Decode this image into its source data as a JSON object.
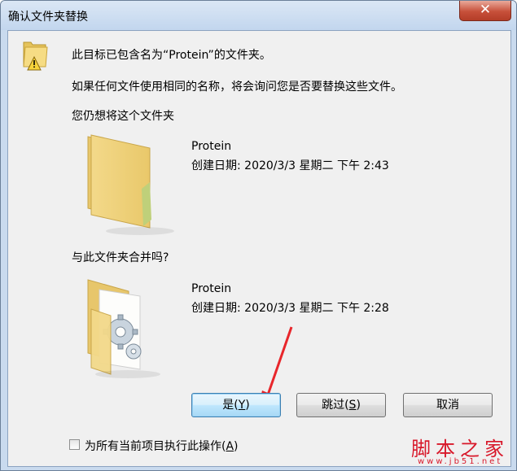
{
  "window": {
    "title": "确认文件夹替换",
    "close_glyph": "✕"
  },
  "message": {
    "line1": "此目标已包含名为“Protein”的文件夹。",
    "line2": "如果任何文件使用相同的名称，将会询问您是否要替换这些文件。",
    "question": "您仍想将这个文件夹",
    "merge_question": "与此文件夹合并吗?"
  },
  "existing_folder": {
    "name": "Protein",
    "created": "创建日期: 2020/3/3 星期二 下午 2:43"
  },
  "incoming_folder": {
    "name": "Protein",
    "created": "创建日期: 2020/3/3 星期二 下午 2:28"
  },
  "buttons": {
    "yes": {
      "text": "是(",
      "key": "Y",
      "tail": ")"
    },
    "skip": {
      "text": "跳过(",
      "key": "S",
      "tail": ")"
    },
    "cancel": {
      "text": "取消"
    }
  },
  "apply_all": {
    "text": "为所有当前项目执行此操作(",
    "key": "A",
    "tail": ")",
    "checked": false
  },
  "watermark": {
    "cn": "脚本之家",
    "url": "www.jb51.net"
  },
  "colors": {
    "accent": "#3c7fb1",
    "arrow": "#e8262b",
    "folder": "#f2d984",
    "watermark": "#d8182a"
  }
}
